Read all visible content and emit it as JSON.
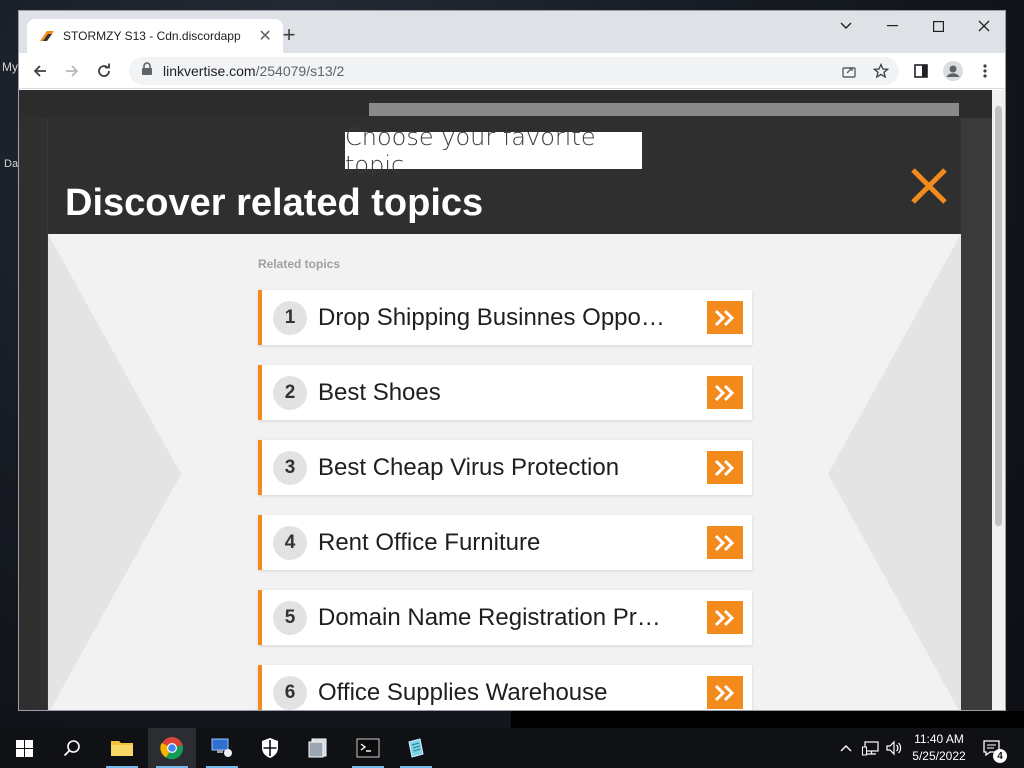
{
  "desktop": {
    "fragments": [
      "My",
      "Da"
    ]
  },
  "browser": {
    "tab": {
      "title": "STORMZY S13 - Cdn.discordapp",
      "close_glyph": "✕"
    },
    "new_tab_glyph": "+",
    "url": {
      "domain": "linkvertise.com",
      "path": "/254079/s13/2"
    }
  },
  "modal": {
    "pill": "Choose your favorite topic",
    "title": "Discover related topics",
    "related_label": "Related topics",
    "topics": [
      {
        "num": "1",
        "label": "Drop Shipping Businnes Oppo…"
      },
      {
        "num": "2",
        "label": "Best Shoes"
      },
      {
        "num": "3",
        "label": "Best Cheap Virus Protection"
      },
      {
        "num": "4",
        "label": "Rent Office Furniture"
      },
      {
        "num": "5",
        "label": "Domain Name Registration Pr…"
      },
      {
        "num": "6",
        "label": "Office Supplies Warehouse"
      }
    ]
  },
  "taskbar": {
    "time": "11:40 AM",
    "date": "5/25/2022",
    "notification_count": "4"
  },
  "colors": {
    "accent": "#f28a1c",
    "modal_header": "#2f2f2f"
  }
}
